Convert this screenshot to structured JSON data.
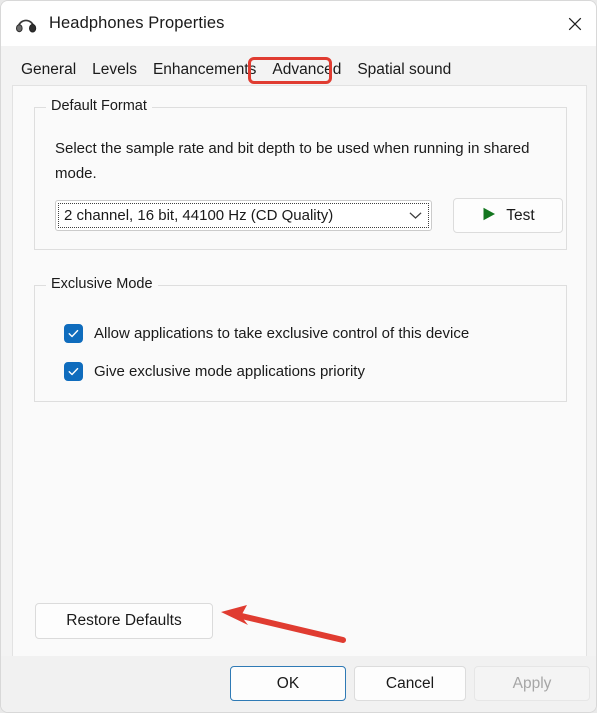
{
  "window": {
    "title": "Headphones Properties",
    "icon": "headphones-icon",
    "close_icon": "close-icon"
  },
  "tabs": [
    {
      "label": "General",
      "selected": false
    },
    {
      "label": "Levels",
      "selected": false
    },
    {
      "label": "Enhancements",
      "selected": false
    },
    {
      "label": "Advanced",
      "selected": true
    },
    {
      "label": "Spatial sound",
      "selected": false
    }
  ],
  "annotations": {
    "tab_highlight_color": "#e03c31",
    "arrow_color": "#e03c31",
    "arrow_target": "Restore Defaults"
  },
  "default_format": {
    "group_label": "Default Format",
    "description": "Select the sample rate and bit depth to be used when running in shared mode.",
    "combo_value": "2 channel, 16 bit, 44100 Hz (CD Quality)",
    "combo_arrow_icon": "chevron-down-icon",
    "test_button": "Test",
    "test_icon": "play-icon",
    "test_icon_color": "#13761f"
  },
  "exclusive_mode": {
    "group_label": "Exclusive Mode",
    "checkboxes": [
      {
        "label": "Allow applications to take exclusive control of this device",
        "checked": true
      },
      {
        "label": "Give exclusive mode applications priority",
        "checked": true
      }
    ],
    "check_color": "#0f6cbd"
  },
  "buttons": {
    "restore_defaults": "Restore Defaults",
    "ok": "OK",
    "cancel": "Cancel",
    "apply": "Apply",
    "apply_enabled": false,
    "ok_accent": "#2f7ab5"
  }
}
